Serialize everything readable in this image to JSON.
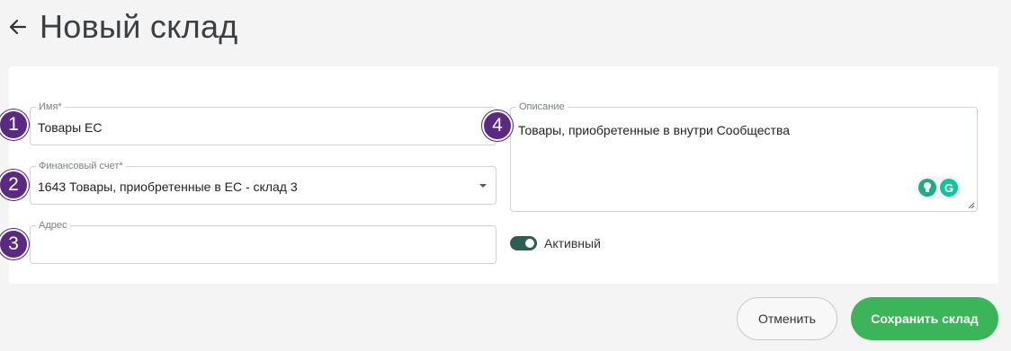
{
  "header": {
    "title": "Новый склад"
  },
  "form": {
    "name": {
      "label": "Имя*",
      "value": "Товары ЕС",
      "badge": "1"
    },
    "account": {
      "label": "Финансовый счет*",
      "value": "1643 Товары, приобретенные в ЕС - склад 3",
      "badge": "2"
    },
    "address": {
      "label": "Адрес",
      "value": "",
      "badge": "3"
    },
    "description": {
      "label": "Описание",
      "value": "Товары, приобретенные в внутри Сообщества",
      "badge": "4"
    },
    "active": {
      "label": "Активный",
      "checked": true
    }
  },
  "actions": {
    "cancel_label": "Отменить",
    "save_label": "Сохранить склад"
  },
  "colors": {
    "accent": "#3cb55a",
    "toggle": "#2f5d53",
    "badge": "#5a2a82"
  },
  "icons": {
    "back": "arrow-left-icon",
    "dropdown": "caret-down-icon",
    "grammarly_bulb": "bulb-icon",
    "grammarly_logo": "grammarly-icon",
    "resize": "resize-handle-icon"
  }
}
